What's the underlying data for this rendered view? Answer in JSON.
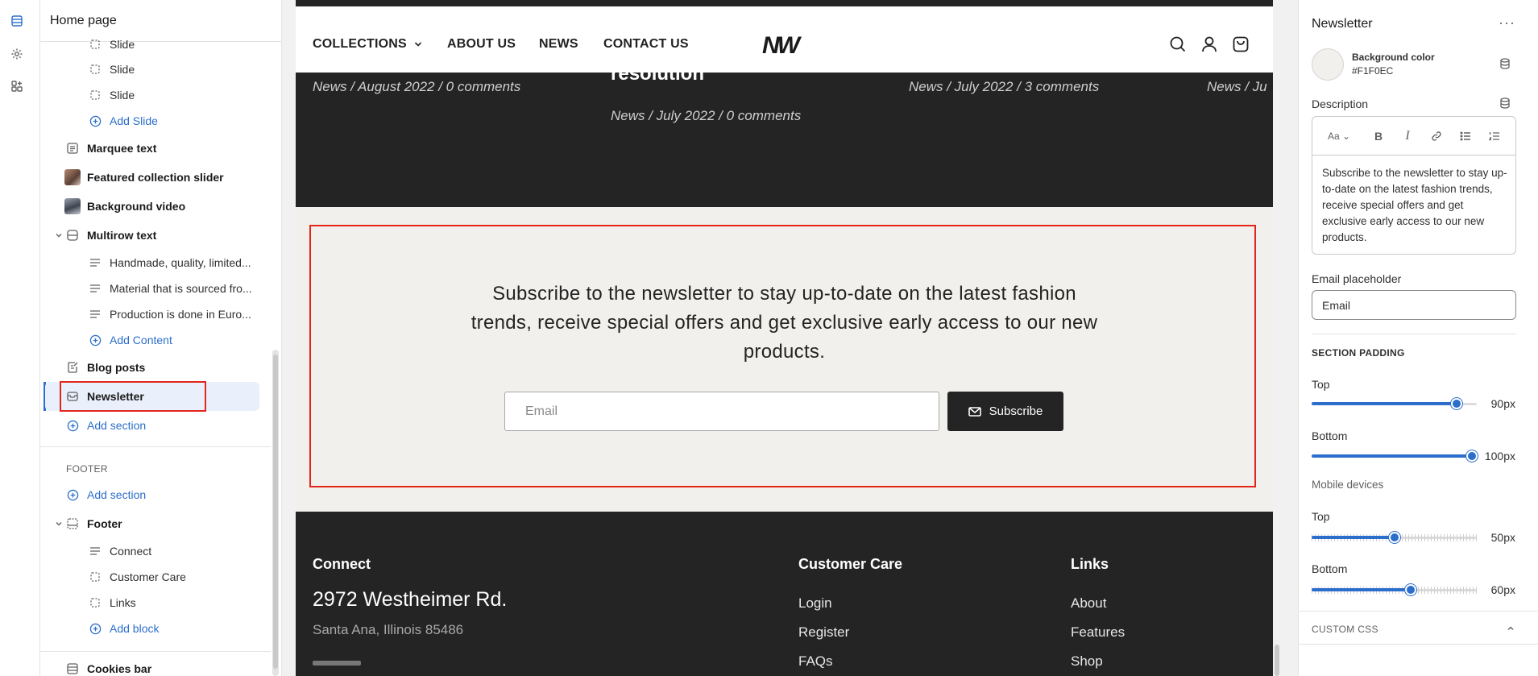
{
  "sidebar": {
    "title": "Home page",
    "items": {
      "slide1": "Slide",
      "slide2": "Slide",
      "slide3": "Slide",
      "add_slide": "Add Slide",
      "marquee": "Marquee text",
      "featured": "Featured collection slider",
      "bgvideo": "Background video",
      "multirow": "Multirow text",
      "row1": "Handmade, quality, limited...",
      "row2": "Material that is sourced fro...",
      "row3": "Production is done in Euro...",
      "add_content": "Add Content",
      "blog": "Blog posts",
      "newsletter": "Newsletter",
      "add_section": "Add section"
    },
    "footer": {
      "label": "FOOTER",
      "add_section": "Add section",
      "footer": "Footer",
      "connect": "Connect",
      "customer_care": "Customer Care",
      "links": "Links",
      "add_block": "Add block",
      "cookies": "Cookies bar"
    }
  },
  "preview": {
    "nav": {
      "collections": "COLLECTIONS",
      "about": "ABOUT US",
      "news": "NEWS",
      "contact": "CONTACT US",
      "logo": "NW"
    },
    "blog": {
      "meta1": "News   /   August 2022   /   0 comments",
      "title2": "resolution",
      "meta2": "News   /   July 2022   /   0 comments",
      "meta3": "News   /   July 2022   /   3 comments",
      "meta4": "News   /   Ju"
    },
    "newsletter": {
      "description": "Subscribe to the newsletter to stay up-to-date on the latest fashion trends, receive special offers and get exclusive early access to our new products.",
      "placeholder": "Email",
      "button": "Subscribe"
    },
    "footer": {
      "connect": "Connect",
      "address": "2972 Westheimer Rd.",
      "city": "Santa Ana, Illinois 85486",
      "customer_care": "Customer Care",
      "cc_links": [
        "Login",
        "Register",
        "FAQs"
      ],
      "links": "Links",
      "links_items": [
        "About",
        "Features",
        "Shop"
      ]
    }
  },
  "panel": {
    "title": "Newsletter",
    "bg_color_label": "Background color",
    "bg_color_value": "#F1F0EC",
    "description_label": "Description",
    "description_text": "Subscribe to the newsletter to stay up-to-date on the latest fashion trends, receive special offers and get exclusive early access to our new products.",
    "email_label": "Email placeholder",
    "email_value": "Email",
    "section_padding": "SECTION PADDING",
    "top_label": "Top",
    "top_value": "90px",
    "top_fraction": 0.9,
    "bottom_label": "Bottom",
    "bottom_value": "100px",
    "bottom_fraction": 1.0,
    "mobile_label": "Mobile devices",
    "m_top_label": "Top",
    "m_top_value": "50px",
    "m_top_fraction": 0.5,
    "m_bottom_label": "Bottom",
    "m_bottom_value": "60px",
    "m_bottom_fraction": 0.6,
    "custom_css": "CUSTOM CSS"
  },
  "colors": {
    "accent": "#2c6ecb",
    "highlight": "#e3261a",
    "newsletter_bg": "#F1F0EC",
    "dark": "#242424"
  }
}
